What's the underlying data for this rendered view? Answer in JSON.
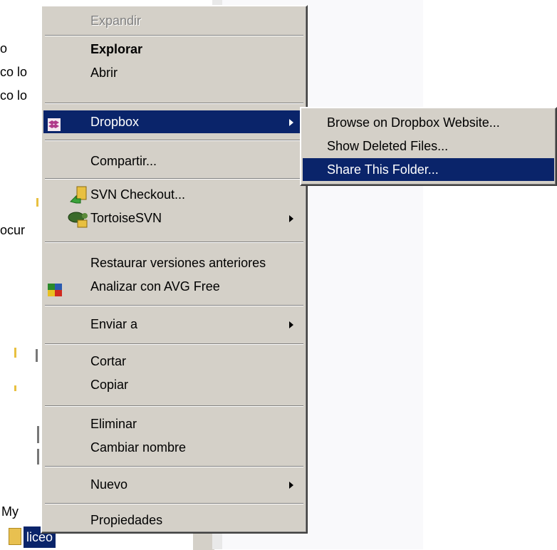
{
  "background": {
    "left_text": [
      "o",
      "co lo",
      "co lo",
      "ocur",
      "My"
    ],
    "selected_item": "liceo"
  },
  "context_menu": {
    "items": [
      {
        "label": "Expandir",
        "state": "disabled"
      },
      {
        "label": "Explorar",
        "state": "default-bold"
      },
      {
        "label": "Abrir"
      },
      {
        "label": "Dropbox",
        "icon": "dropbox-icon",
        "submenu": true,
        "state": "highlighted"
      },
      {
        "label": "Compartir..."
      },
      {
        "label": "SVN Checkout...",
        "icon": "svn-checkout-icon"
      },
      {
        "label": "TortoiseSVN",
        "icon": "tortoisesvn-icon",
        "submenu": true
      },
      {
        "label": "Restaurar versiones anteriores"
      },
      {
        "label": "Analizar con AVG Free",
        "icon": "avg-icon"
      },
      {
        "label": "Enviar a",
        "submenu": true
      },
      {
        "label": "Cortar"
      },
      {
        "label": "Copiar"
      },
      {
        "label": "Eliminar"
      },
      {
        "label": "Cambiar nombre"
      },
      {
        "label": "Nuevo",
        "submenu": true
      },
      {
        "label": "Propiedades"
      }
    ]
  },
  "dropbox_submenu": {
    "items": [
      {
        "label": "Browse on Dropbox Website..."
      },
      {
        "label": "Show Deleted Files..."
      },
      {
        "label": "Share This Folder...",
        "state": "highlighted"
      }
    ]
  },
  "colors": {
    "menu_face": "#d4d0c8",
    "highlight": "#0a246a",
    "disabled_text": "#808080"
  }
}
